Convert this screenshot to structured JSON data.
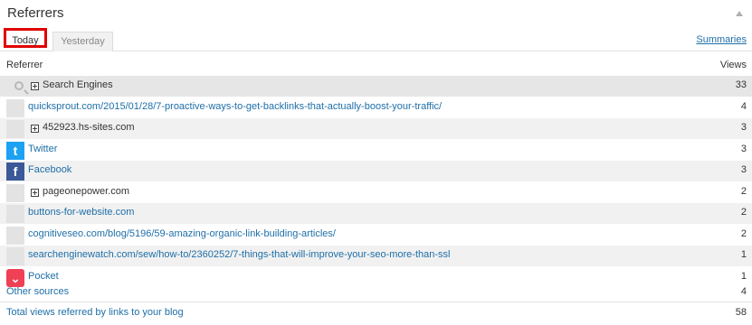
{
  "widget": {
    "title": "Referrers",
    "tabs": [
      {
        "label": "Today"
      },
      {
        "label": "Yesterday"
      }
    ],
    "summaries_link": "Summaries"
  },
  "table": {
    "header_left": "Referrer",
    "header_right": "Views",
    "rows": [
      {
        "label": "Search Engines",
        "views": "33"
      },
      {
        "label": "quicksprout.com/2015/01/28/7-proactive-ways-to-get-backlinks-that-actually-boost-your-traffic/",
        "views": "4"
      },
      {
        "label": "452923.hs-sites.com",
        "views": "3"
      },
      {
        "label": "Twitter",
        "views": "3"
      },
      {
        "label": "Facebook",
        "views": "3"
      },
      {
        "label": "pageonepower.com",
        "views": "2"
      },
      {
        "label": "buttons-for-website.com",
        "views": "2"
      },
      {
        "label": "cognitiveseo.com/blog/5196/59-amazing-organic-link-building-articles/",
        "views": "2"
      },
      {
        "label": "searchenginewatch.com/sew/how-to/2360252/7-things-that-will-improve-your-seo-more-than-ssl",
        "views": "1"
      },
      {
        "label": "Pocket",
        "views": "1"
      }
    ]
  },
  "footer": {
    "other_sources": {
      "label": "Other sources",
      "views": "4"
    },
    "total": {
      "label": "Total views referred by links to your blog",
      "views": "58"
    }
  },
  "icons": {
    "search": "search-icon",
    "twitter": "twitter-icon",
    "facebook": "facebook-icon",
    "pocket": "pocket-icon",
    "expand": "plus-box-icon"
  },
  "colors": {
    "link": "#1e6fa8",
    "highlight": "#e00000",
    "twitter": "#1da1f2",
    "facebook": "#3b5998",
    "pocket": "#ef4056"
  }
}
